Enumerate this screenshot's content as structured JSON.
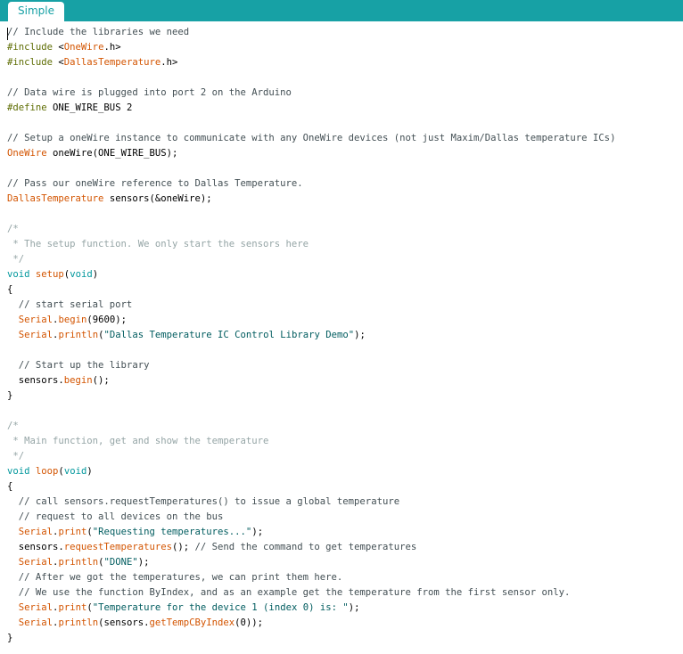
{
  "tab": {
    "label": "Simple"
  },
  "code": {
    "lines": [
      [
        {
          "t": "// Include the libraries we need",
          "c": "cmt"
        }
      ],
      [
        {
          "t": "#include ",
          "c": "pp"
        },
        {
          "t": "<",
          "c": ""
        },
        {
          "t": "OneWire",
          "c": "kw"
        },
        {
          "t": ".h>",
          "c": ""
        }
      ],
      [
        {
          "t": "#include ",
          "c": "pp"
        },
        {
          "t": "<",
          "c": ""
        },
        {
          "t": "DallasTemperature",
          "c": "kw"
        },
        {
          "t": ".h>",
          "c": ""
        }
      ],
      [],
      [
        {
          "t": "// Data wire is plugged into port 2 on the Arduino",
          "c": "cmt"
        }
      ],
      [
        {
          "t": "#define ",
          "c": "pp"
        },
        {
          "t": "ONE_WIRE_BUS 2",
          "c": ""
        }
      ],
      [],
      [
        {
          "t": "// Setup a oneWire instance to communicate with any OneWire devices (not just Maxim/Dallas temperature ICs)",
          "c": "cmt"
        }
      ],
      [
        {
          "t": "OneWire",
          "c": "kw"
        },
        {
          "t": " oneWire(ONE_WIRE_BUS);",
          "c": ""
        }
      ],
      [],
      [
        {
          "t": "// Pass our oneWire reference to Dallas Temperature.",
          "c": "cmt"
        }
      ],
      [
        {
          "t": "DallasTemperature",
          "c": "kw"
        },
        {
          "t": " sensors(&oneWire);",
          "c": ""
        }
      ],
      [],
      [
        {
          "t": "/*",
          "c": "blk"
        }
      ],
      [
        {
          "t": " * The setup function. We only start the sensors here",
          "c": "blk"
        }
      ],
      [
        {
          "t": " */",
          "c": "blk"
        }
      ],
      [
        {
          "t": "void",
          "c": "ty"
        },
        {
          "t": " ",
          "c": ""
        },
        {
          "t": "setup",
          "c": "kw"
        },
        {
          "t": "(",
          "c": ""
        },
        {
          "t": "void",
          "c": "ty"
        },
        {
          "t": ")",
          "c": ""
        }
      ],
      [
        {
          "t": "{",
          "c": ""
        }
      ],
      [
        {
          "t": "  // start serial port",
          "c": "cmt"
        }
      ],
      [
        {
          "t": "  ",
          "c": ""
        },
        {
          "t": "Serial",
          "c": "kw"
        },
        {
          "t": ".",
          "c": ""
        },
        {
          "t": "begin",
          "c": "kw"
        },
        {
          "t": "(9600);",
          "c": ""
        }
      ],
      [
        {
          "t": "  ",
          "c": ""
        },
        {
          "t": "Serial",
          "c": "kw"
        },
        {
          "t": ".",
          "c": ""
        },
        {
          "t": "println",
          "c": "kw"
        },
        {
          "t": "(",
          "c": ""
        },
        {
          "t": "\"Dallas Temperature IC Control Library Demo\"",
          "c": "str"
        },
        {
          "t": ");",
          "c": ""
        }
      ],
      [],
      [
        {
          "t": "  // Start up the library",
          "c": "cmt"
        }
      ],
      [
        {
          "t": "  sensors.",
          "c": ""
        },
        {
          "t": "begin",
          "c": "kw"
        },
        {
          "t": "();",
          "c": ""
        }
      ],
      [
        {
          "t": "}",
          "c": ""
        }
      ],
      [],
      [
        {
          "t": "/*",
          "c": "blk"
        }
      ],
      [
        {
          "t": " * Main function, get and show the temperature",
          "c": "blk"
        }
      ],
      [
        {
          "t": " */",
          "c": "blk"
        }
      ],
      [
        {
          "t": "void",
          "c": "ty"
        },
        {
          "t": " ",
          "c": ""
        },
        {
          "t": "loop",
          "c": "kw"
        },
        {
          "t": "(",
          "c": ""
        },
        {
          "t": "void",
          "c": "ty"
        },
        {
          "t": ")",
          "c": ""
        }
      ],
      [
        {
          "t": "{",
          "c": ""
        }
      ],
      [
        {
          "t": "  // call sensors.requestTemperatures() to issue a global temperature",
          "c": "cmt"
        }
      ],
      [
        {
          "t": "  // request to all devices on the bus",
          "c": "cmt"
        }
      ],
      [
        {
          "t": "  ",
          "c": ""
        },
        {
          "t": "Serial",
          "c": "kw"
        },
        {
          "t": ".",
          "c": ""
        },
        {
          "t": "print",
          "c": "kw"
        },
        {
          "t": "(",
          "c": ""
        },
        {
          "t": "\"Requesting temperatures...\"",
          "c": "str"
        },
        {
          "t": ");",
          "c": ""
        }
      ],
      [
        {
          "t": "  sensors.",
          "c": ""
        },
        {
          "t": "requestTemperatures",
          "c": "kw"
        },
        {
          "t": "(); ",
          "c": ""
        },
        {
          "t": "// Send the command to get temperatures",
          "c": "cmt"
        }
      ],
      [
        {
          "t": "  ",
          "c": ""
        },
        {
          "t": "Serial",
          "c": "kw"
        },
        {
          "t": ".",
          "c": ""
        },
        {
          "t": "println",
          "c": "kw"
        },
        {
          "t": "(",
          "c": ""
        },
        {
          "t": "\"DONE\"",
          "c": "str"
        },
        {
          "t": ");",
          "c": ""
        }
      ],
      [
        {
          "t": "  // After we got the temperatures, we can print them here.",
          "c": "cmt"
        }
      ],
      [
        {
          "t": "  // We use the function ByIndex, and as an example get the temperature from the first sensor only.",
          "c": "cmt"
        }
      ],
      [
        {
          "t": "  ",
          "c": ""
        },
        {
          "t": "Serial",
          "c": "kw"
        },
        {
          "t": ".",
          "c": ""
        },
        {
          "t": "print",
          "c": "kw"
        },
        {
          "t": "(",
          "c": ""
        },
        {
          "t": "\"Temperature for the device 1 (index 0) is: \"",
          "c": "str"
        },
        {
          "t": ");",
          "c": ""
        }
      ],
      [
        {
          "t": "  ",
          "c": ""
        },
        {
          "t": "Serial",
          "c": "kw"
        },
        {
          "t": ".",
          "c": ""
        },
        {
          "t": "println",
          "c": "kw"
        },
        {
          "t": "(sensors.",
          "c": ""
        },
        {
          "t": "getTempCByIndex",
          "c": "kw"
        },
        {
          "t": "(0));",
          "c": ""
        }
      ],
      [
        {
          "t": "}",
          "c": ""
        }
      ]
    ]
  }
}
